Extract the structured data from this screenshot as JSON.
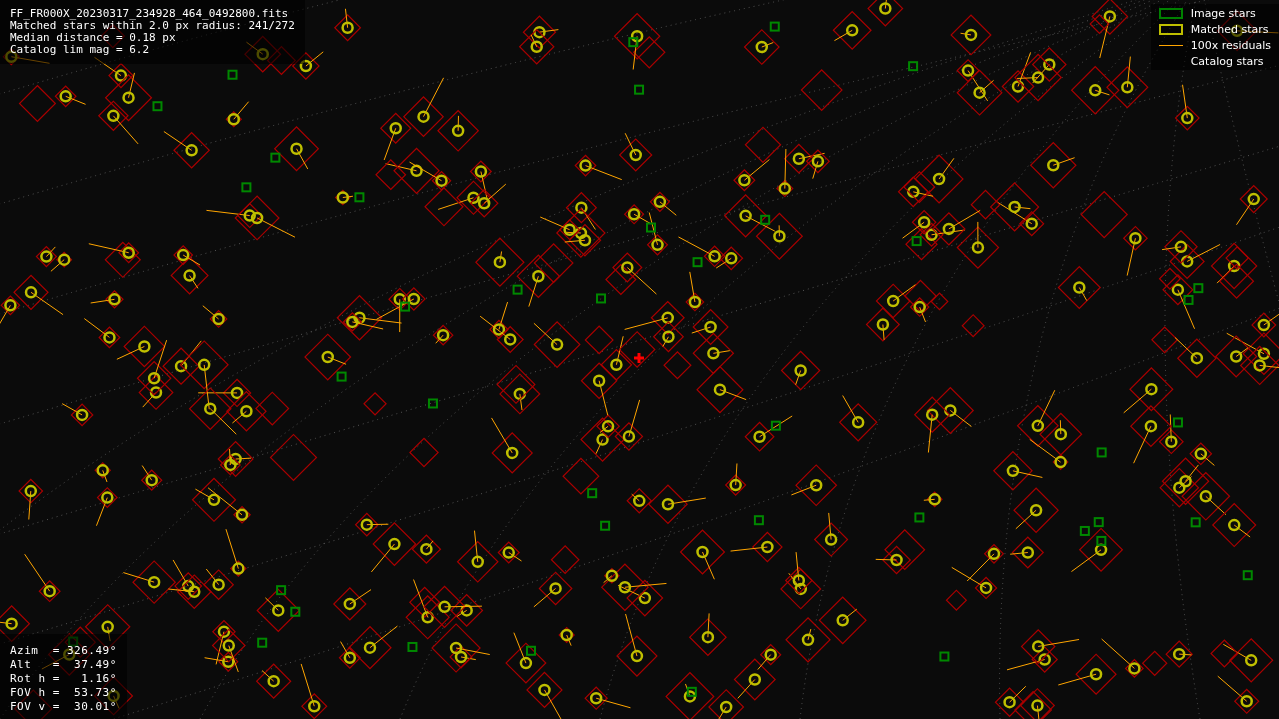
{
  "info": {
    "lines": [
      "FF_FR000X_20230317_234928_464_0492800.fits",
      "Matched stars within 2.0 px radius: 241/272",
      "Median distance = 0.18 px",
      "Catalog lim mag = 6.2"
    ]
  },
  "legend": [
    {
      "kind": "box",
      "color": "#008000",
      "label": "Image stars"
    },
    {
      "kind": "box",
      "color": "#bfbf00",
      "label": "Matched stars"
    },
    {
      "kind": "line",
      "color": "#ffa500",
      "label": "100x residuals"
    },
    {
      "kind": "none",
      "label": "Catalog stars"
    }
  ],
  "pointing": {
    "lines": [
      "Azim  = 326.49°",
      "Alt   =  37.49°",
      "Rot h =   1.16°",
      "FOV h =  53.73°",
      "FOV v =  30.01°"
    ]
  }
}
